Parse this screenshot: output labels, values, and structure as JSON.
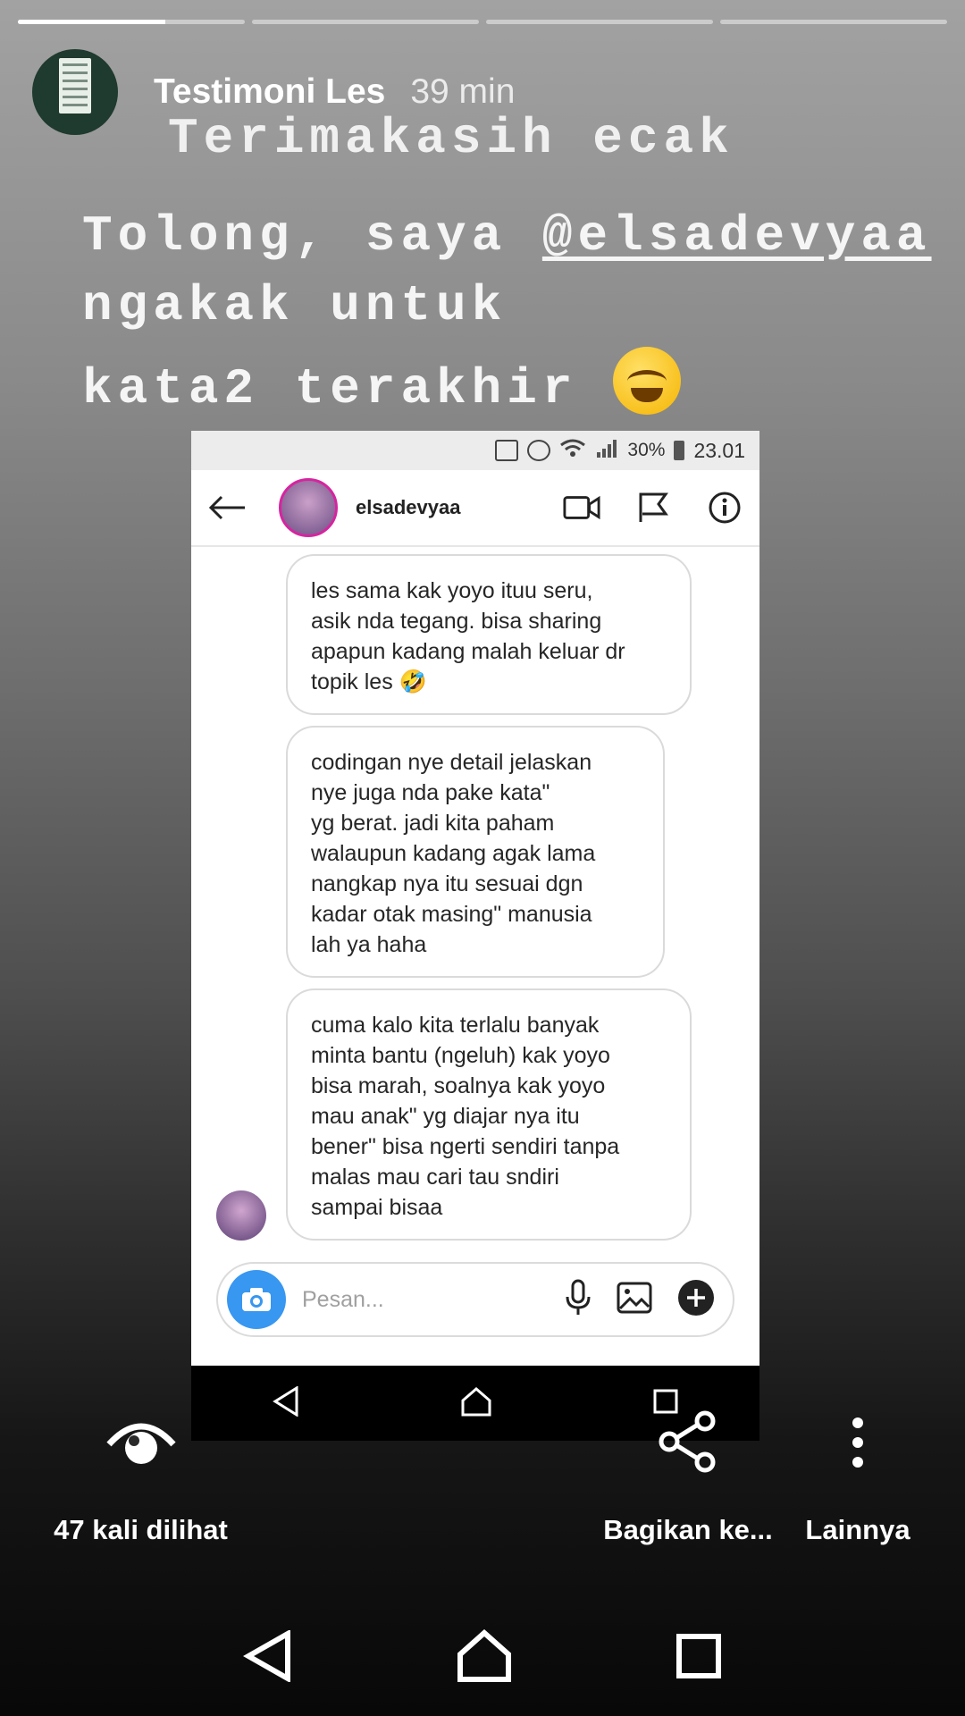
{
  "story": {
    "progress": [
      0.65,
      0,
      0,
      0
    ],
    "account_name": "Testimoni Les",
    "time_ago": "39 min",
    "text_line1": "Terimakasih ecak",
    "text_line2_prefix": "Tolong, saya ",
    "mention": "@elsadevyaa",
    "text_line3": "ngakak untuk",
    "text_line4": "kata2 terakhir"
  },
  "screenshot": {
    "status_bar": {
      "battery": "30%",
      "time": "23.01"
    },
    "chat_username": "elsadevyaa",
    "messages": [
      "les sama kak yoyo ituu seru,\nasik nda tegang. bisa sharing\napapun kadang malah keluar dr\ntopik les 🤣",
      "codingan nye detail jelaskan\nnye juga nda pake kata\"\nyg berat. jadi kita paham\nwalaupun kadang agak lama\nnangkap nya itu sesuai dgn\nkadar otak masing\" manusia\nlah ya haha",
      "cuma kalo kita terlalu banyak\nminta bantu (ngeluh) kak yoyo\nbisa marah, soalnya kak yoyo\nmau anak\" yg diajar nya itu\nbener\" bisa ngerti sendiri tanpa\nmalas mau cari tau sndiri\nsampai bisaa"
    ],
    "composer_placeholder": "Pesan..."
  },
  "footer": {
    "views_label": "47 kali dilihat",
    "share_label": "Bagikan ke...",
    "more_label": "Lainnya"
  },
  "icons": [
    "eye-icon",
    "share-icon",
    "more-vertical-icon",
    "back-arrow-icon",
    "video-call-icon",
    "flag-icon",
    "info-icon",
    "camera-icon",
    "microphone-icon",
    "gallery-icon",
    "plus-icon",
    "nav-back-icon",
    "nav-home-icon",
    "nav-recent-icon"
  ],
  "colors": {
    "instagram_blue": "#3897f0",
    "story_ring": "#d6249f"
  }
}
